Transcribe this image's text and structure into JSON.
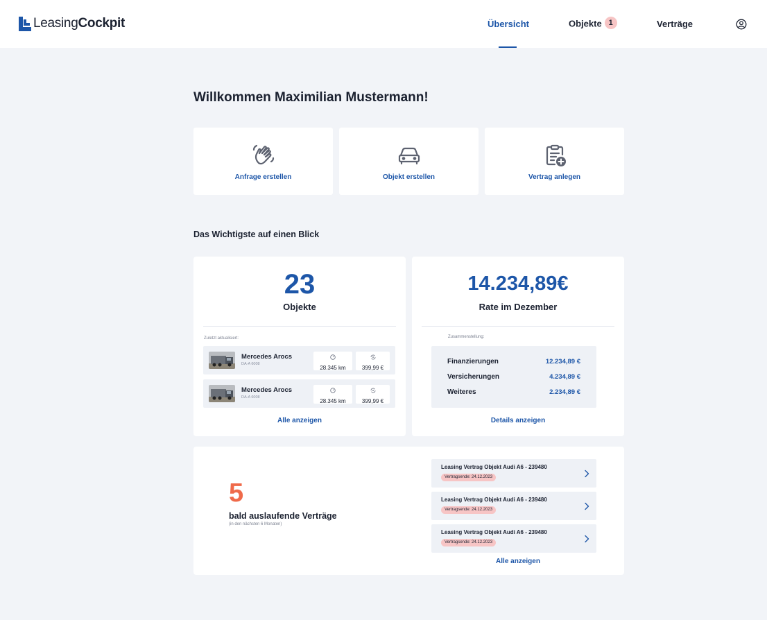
{
  "app": {
    "logo_part1": "Leasing",
    "logo_part2": "Cockpit"
  },
  "nav": {
    "items": [
      {
        "label": "Übersicht",
        "active": true
      },
      {
        "label": "Objekte",
        "badge": "1"
      },
      {
        "label": "Verträge"
      }
    ],
    "profile_icon": "user-circle-icon"
  },
  "welcome": "Willkommen Maximilian Mustermann!",
  "actions": [
    {
      "label": "Anfrage erstellen",
      "icon": "hand-wave-icon"
    },
    {
      "label": "Objekt erstellen",
      "icon": "car-icon"
    },
    {
      "label": "Vertrag anlegen",
      "icon": "clipboard-add-icon"
    }
  ],
  "section_title": "Das Wichtigste auf einen Blick",
  "objects_card": {
    "count": "23",
    "label": "Objekte",
    "updated_label": "Zuletzt aktualisiert:",
    "items": [
      {
        "name": "Mercedes Arocs",
        "plate": "DA-A 6008",
        "mileage": "28.345 km",
        "rate": "399,99 €"
      },
      {
        "name": "Mercedes Arocs",
        "plate": "DA-A 6008",
        "mileage": "28.345 km",
        "rate": "399,99 €"
      }
    ],
    "link": "Alle anzeigen"
  },
  "rate_card": {
    "amount": "14.234,89€",
    "label": "Rate im Dezember",
    "summary_label": "Zusammenstellung:",
    "rows": [
      {
        "label": "Finanzierungen",
        "value": "12.234,89 €"
      },
      {
        "label": "Versicherungen",
        "value": "4.234,89 €"
      },
      {
        "label": "Weiteres",
        "value": "2.234,89 €"
      }
    ],
    "link": "Details anzeigen"
  },
  "contracts_card": {
    "count": "5",
    "label": "bald auslaufende Verträge",
    "sublabel": "(in den nächsten 6 Monaten)",
    "items": [
      {
        "title": "Leasing Vertrag Objekt Audi A6 - 239480",
        "tag": "Vertragsende: 24.12.2023"
      },
      {
        "title": "Leasing Vertrag Objekt Audi A6 - 239480",
        "tag": "Vertragsende: 24.12.2023"
      },
      {
        "title": "Leasing Vertrag Objekt Audi A6 - 239480",
        "tag": "Vertragsende: 24.12.2023"
      }
    ],
    "link": "Alle anzeigen"
  },
  "colors": {
    "primary": "#1d56a8",
    "accent": "#ef6a4a",
    "badge": "#f7c5c5",
    "background": "#f2f4f8"
  }
}
